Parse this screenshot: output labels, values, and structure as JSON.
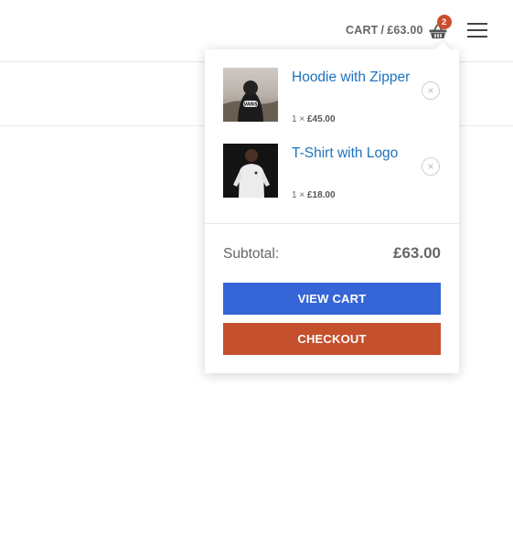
{
  "header": {
    "cart_label": "CART",
    "cart_separator": "/",
    "cart_total": "£63.00",
    "cart_count": "2",
    "colors": {
      "badge": "#cc4d2c",
      "link": "#1e73be"
    }
  },
  "mini_cart": {
    "items": [
      {
        "name": "Hoodie with Zipper",
        "quantity": "1 ×",
        "price": "£45.00",
        "image": "hoodie-photo"
      },
      {
        "name": "T-Shirt with Logo",
        "quantity": "1 ×",
        "price": "£18.00",
        "image": "tshirt-photo"
      }
    ],
    "remove_icon": "×",
    "subtotal_label": "Subtotal:",
    "subtotal_value": "£63.00",
    "view_cart_label": "VIEW CART",
    "checkout_label": "CHECKOUT",
    "colors": {
      "view_cart": "#3565d6",
      "checkout": "#c4502c"
    }
  }
}
